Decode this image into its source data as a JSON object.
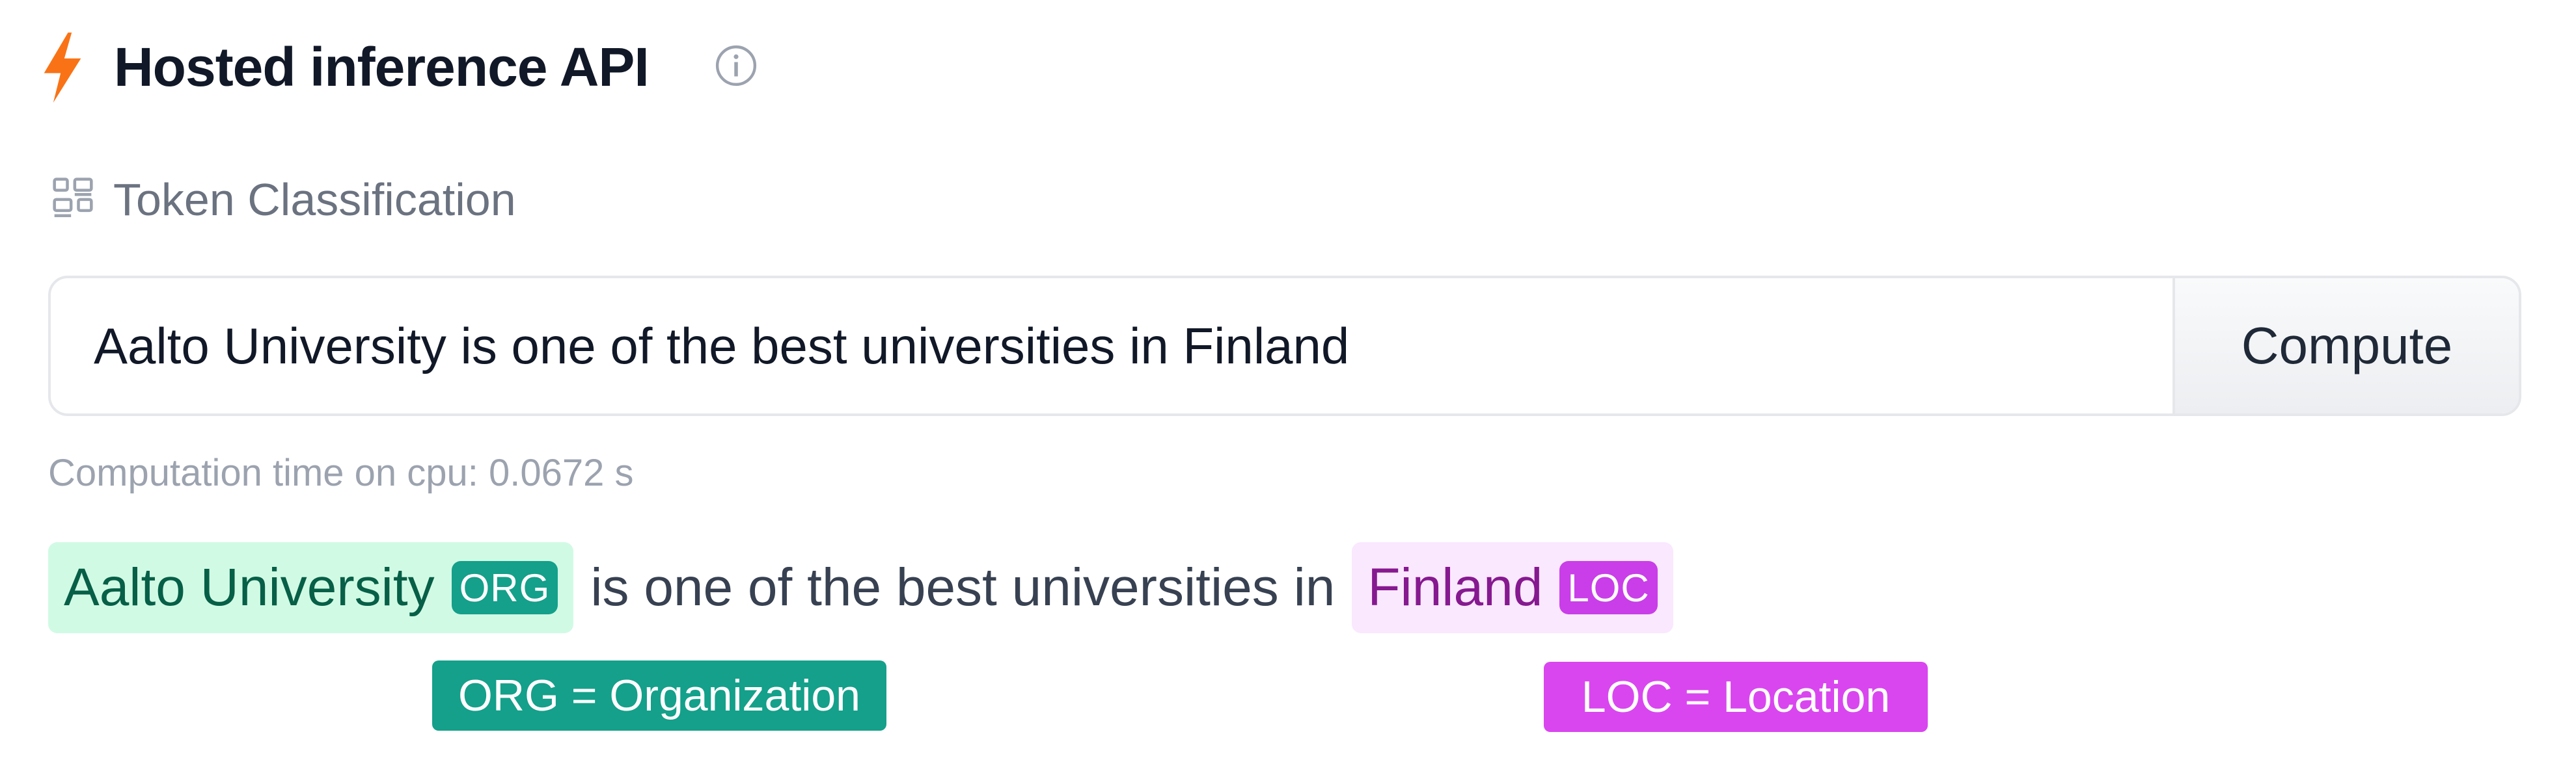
{
  "header": {
    "title": "Hosted inference API",
    "icon": "lightning-bolt-icon",
    "info_icon": "info-icon",
    "accent_color": "#f97316"
  },
  "task": {
    "icon": "token-classification-icon",
    "label": "Token Classification"
  },
  "input": {
    "value": "Aalto University is one of the best universities in Finland",
    "button_label": "Compute"
  },
  "timing_text": "Computation time on cpu: 0.0672 s",
  "result": {
    "entity_org_text": "Aalto University",
    "entity_org_tag": "ORG",
    "middle_text": "is one of the best universities in",
    "entity_loc_text": "Finland",
    "entity_loc_tag": "LOC"
  },
  "legend": {
    "org": "ORG = Organization",
    "loc": "LOC = Location"
  },
  "colors": {
    "org_highlight": "#d1fae5",
    "org_tag": "#14a08a",
    "loc_highlight": "#fae8ff",
    "loc_tag": "#c93ee8"
  }
}
